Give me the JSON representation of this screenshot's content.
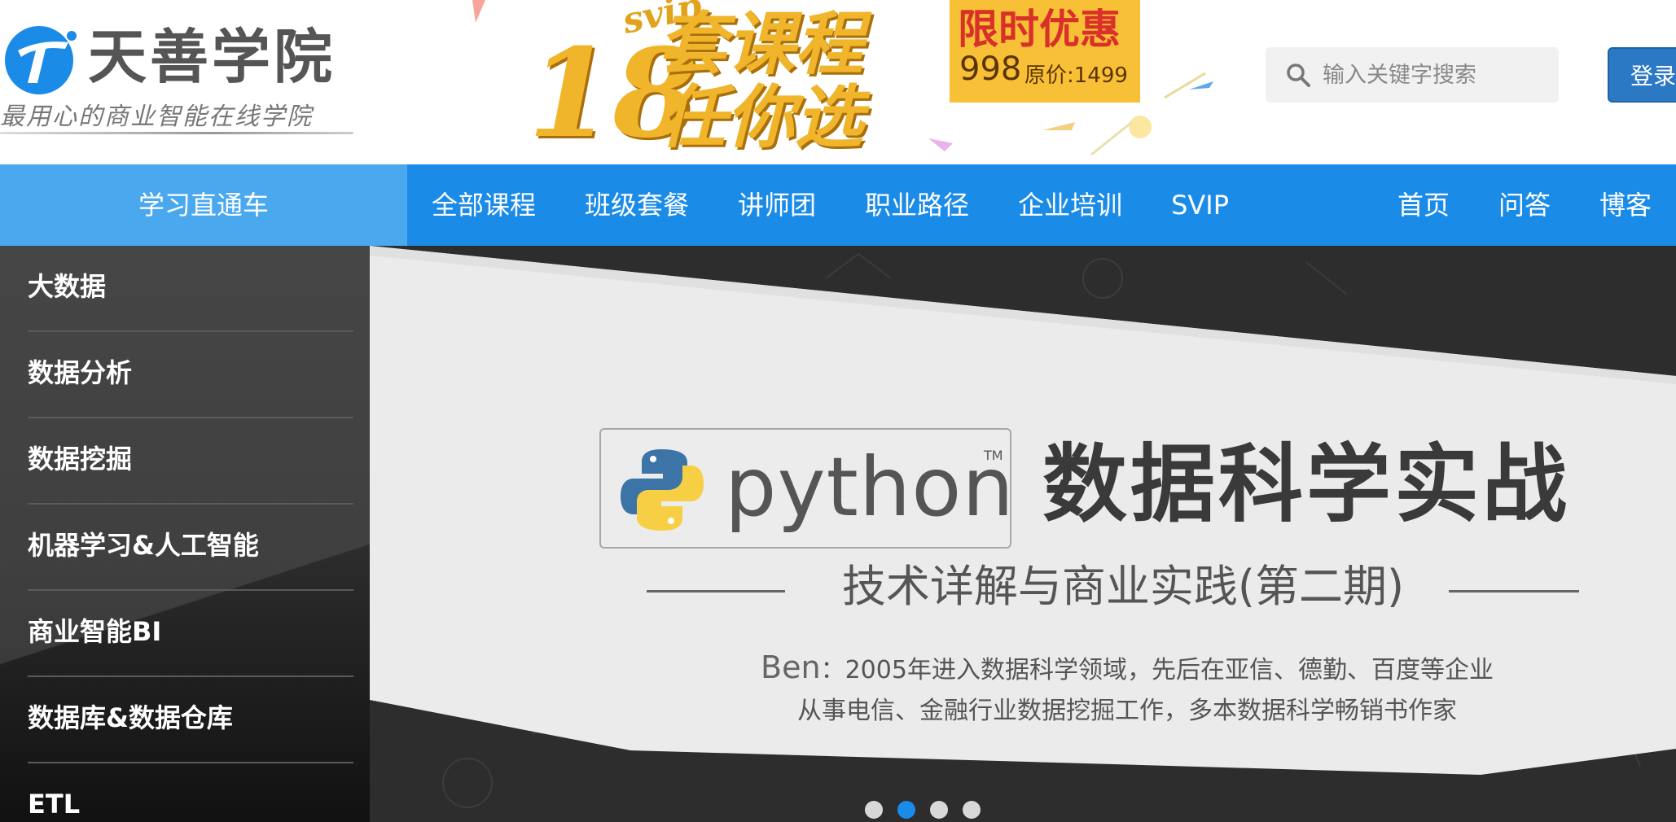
{
  "header": {
    "logo_title": "天善学院",
    "logo_slogan": "最用心的商业智能在线学院",
    "promo": {
      "tag": "svip",
      "big_number": "18",
      "line1": "套课程",
      "line2": "任你选"
    },
    "deal": {
      "title": "限时优惠",
      "price": "998",
      "original": "原价:1499"
    },
    "search": {
      "placeholder": "输入关键字搜索"
    },
    "login_label": "登录"
  },
  "nav": {
    "feature": "学习直通车",
    "items": [
      "全部课程",
      "班级套餐",
      "讲师团",
      "职业路径",
      "企业培训",
      "SVIP"
    ],
    "right_items": [
      "首页",
      "问答",
      "博客"
    ]
  },
  "sidebar": {
    "items": [
      "大数据",
      "数据分析",
      "数据挖掘",
      "机器学习&人工智能",
      "商业智能BI",
      "数据库&数据仓库",
      "ETL"
    ]
  },
  "banner": {
    "python_word": "python",
    "python_tm": "TM",
    "title": "数据科学实战",
    "subtitle": "技术详解与商业实践(第二期)",
    "desc_name": "Ben",
    "desc_line1": "：2005年进入数据科学领域，先后在亚信、德勤、百度等企业",
    "desc_line2": "从事电信、金融行业数据挖掘工作，多本数据科学畅销书作家",
    "carousel": {
      "count": 4,
      "active_index": 1
    }
  },
  "colors": {
    "nav_blue": "#1b8be8",
    "nav_feature_blue": "#4aa8ef",
    "login_blue": "#2b78c5",
    "promo_gold": "#f0b52a",
    "deal_red": "#d9302a",
    "deal_yellow": "#f8c037"
  }
}
